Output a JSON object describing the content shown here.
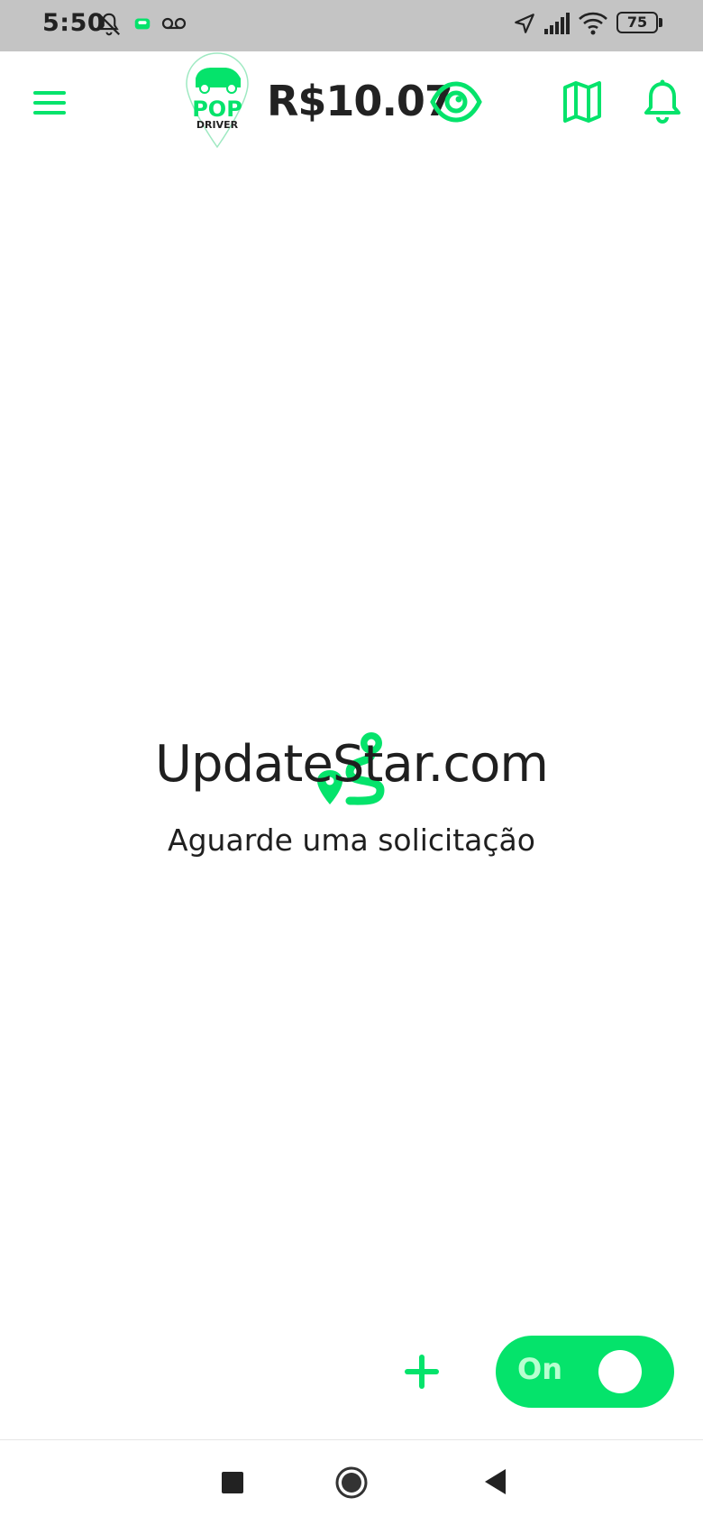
{
  "status_bar": {
    "time": "5:50",
    "battery": "75",
    "icons": [
      "notifications-off-icon",
      "app-notification-icon",
      "voicemail-icon",
      "location-arrow-icon",
      "cell-signal-icon",
      "wifi-icon",
      "battery-icon"
    ]
  },
  "app_bar": {
    "logo_text_top": "POP",
    "logo_text_bottom": "DRIVER",
    "balance": "R$10.07",
    "icons": [
      "menu-icon",
      "eye-icon",
      "map-icon",
      "bell-icon"
    ]
  },
  "main": {
    "watermark": "UpdateStar.com",
    "waiting_message": "Aguarde uma solicitação"
  },
  "controls": {
    "toggle_label": "On",
    "add_icon": "plus-icon"
  },
  "colors": {
    "accent": "#05e36b",
    "text": "#222222",
    "status_bar_bg": "#c4c4c4"
  }
}
